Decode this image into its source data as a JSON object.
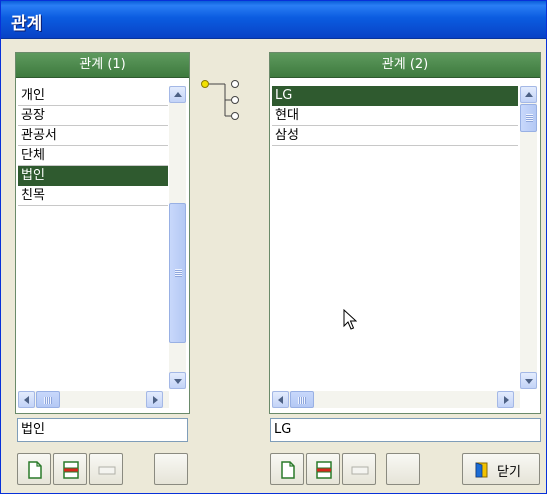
{
  "window": {
    "title": "관계"
  },
  "left_panel": {
    "header": "관계 (1)",
    "items": [
      "개인",
      "공장",
      "관공서",
      "단체",
      "법인",
      "친목"
    ],
    "selected_index": 4,
    "field_value": "법인"
  },
  "right_panel": {
    "header": "관계 (2)",
    "items": [
      "LG",
      "현대",
      "삼성"
    ],
    "selected_index": 0,
    "field_value": "LG"
  },
  "buttons": {
    "close_label": "닫기"
  },
  "icons": {
    "relation": "tree-connector-icon",
    "new": "new-document-icon",
    "edit": "edit-rows-icon",
    "delete": "delete-icon",
    "close": "door-exit-icon",
    "cursor": "mouse-pointer-icon"
  },
  "colors": {
    "title_bar": "#0b5ce0",
    "panel_header": "#3e7a3e",
    "selection": "#2f5a2f",
    "scroll": "#c3d3f7"
  }
}
